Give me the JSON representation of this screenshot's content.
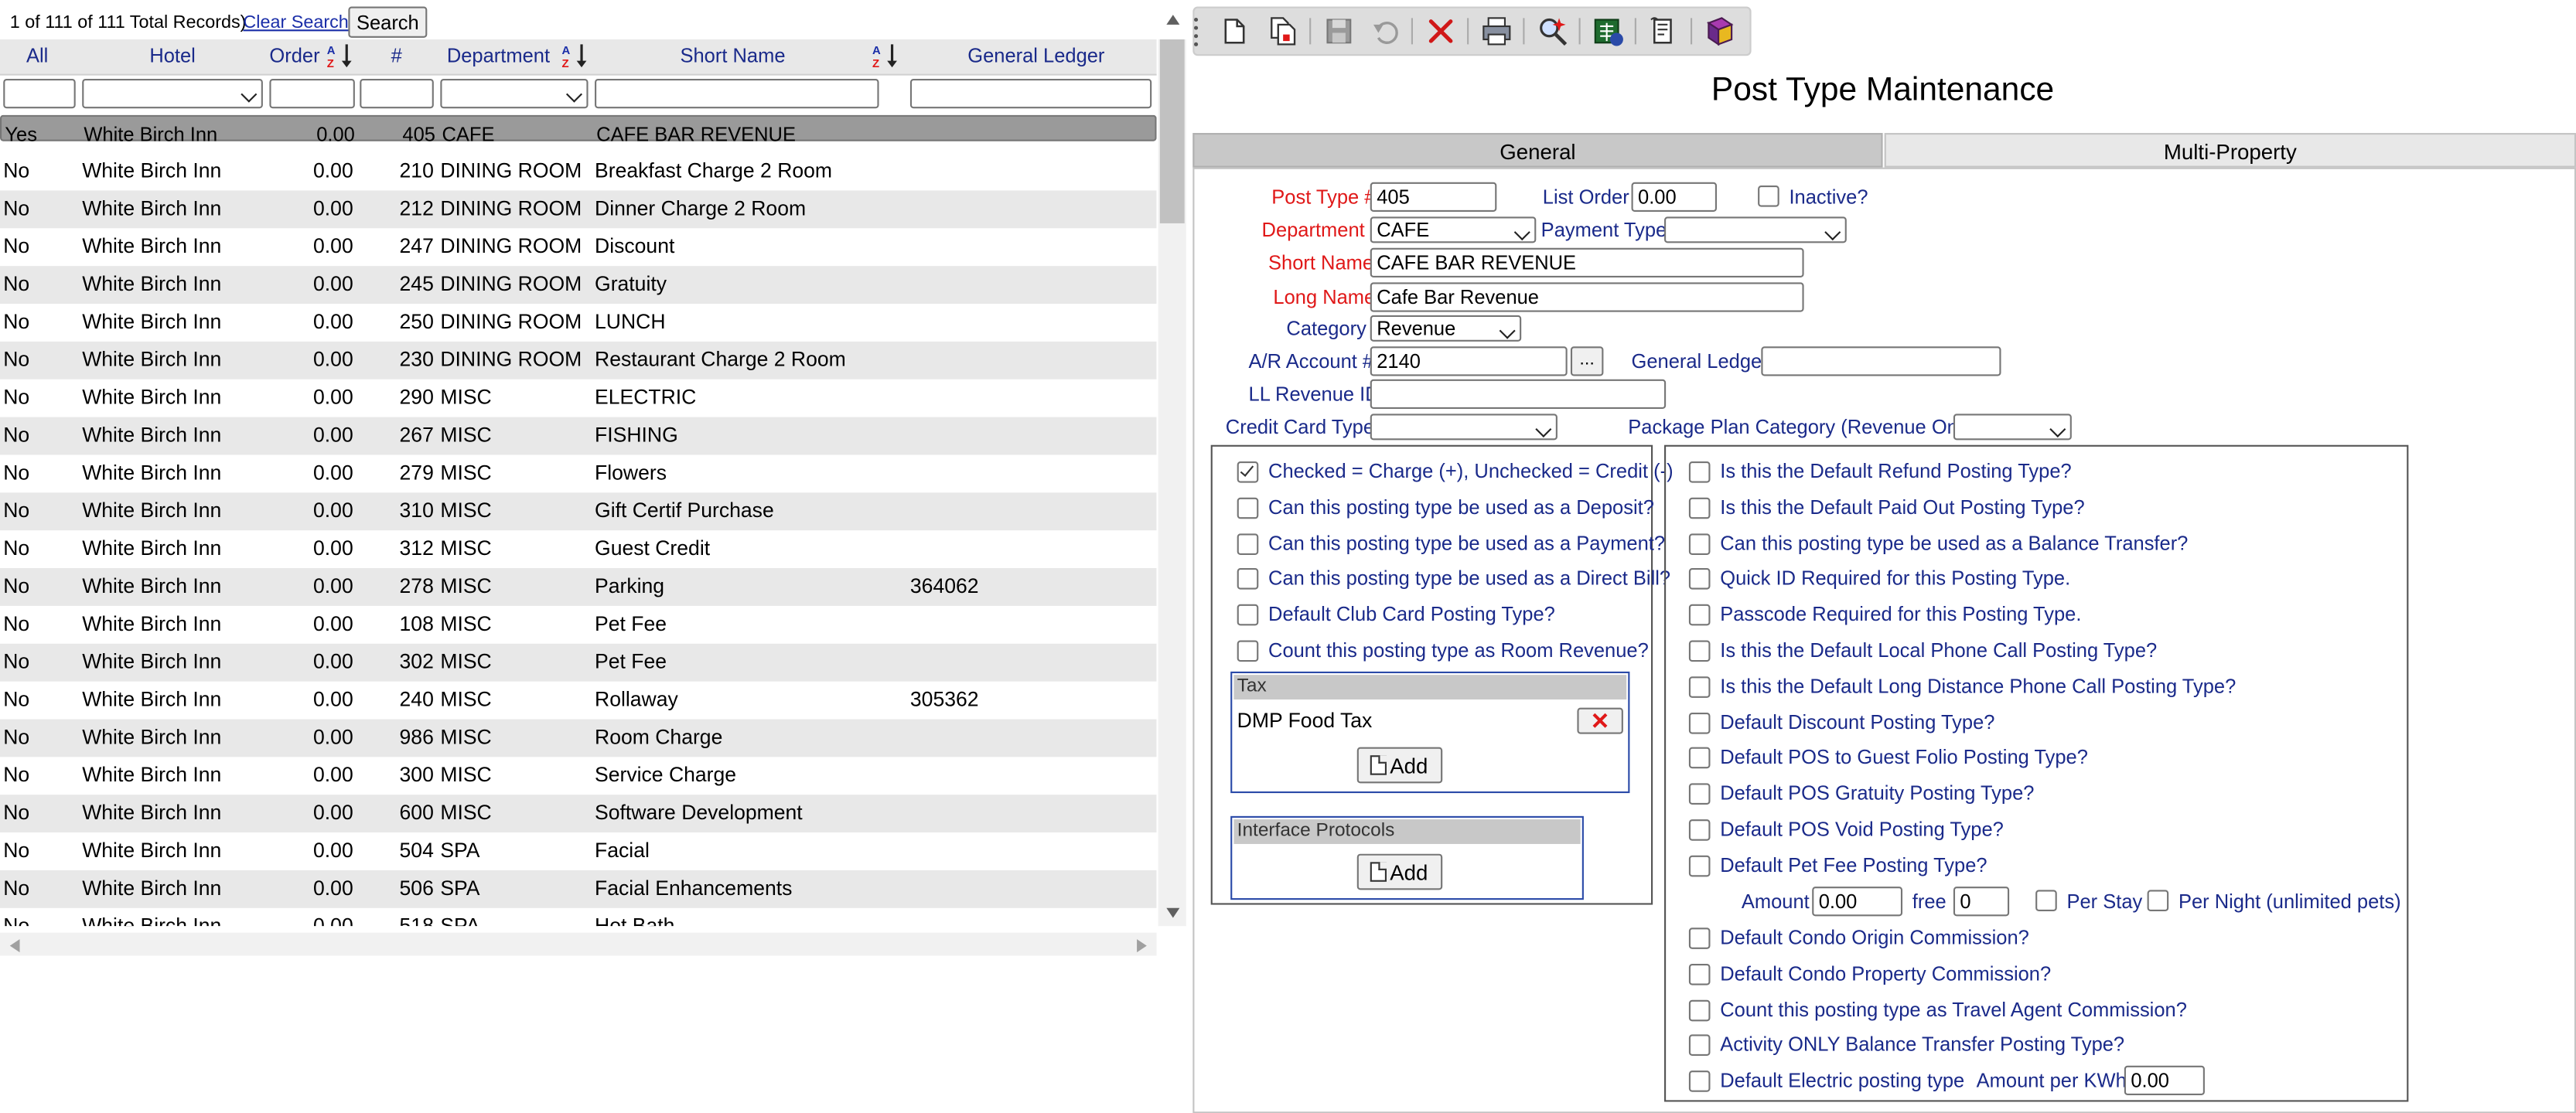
{
  "grid": {
    "record_info": "1 of 111 of 111 Total Records)",
    "clear_search": "Clear Search",
    "search_button": "Search",
    "columns": {
      "all": "All",
      "hotel": "Hotel",
      "order": "Order",
      "num": "#",
      "department": "Department",
      "short_name": "Short Name",
      "general_ledger": "General Ledger"
    },
    "rows": [
      {
        "all": "Yes",
        "hotel": "White Birch Inn",
        "order": "0.00",
        "num": "405",
        "dept": "CAFE",
        "short": "CAFE BAR REVENUE",
        "gl": ""
      },
      {
        "all": "No",
        "hotel": "White Birch Inn",
        "order": "0.00",
        "num": "210",
        "dept": "DINING ROOM",
        "short": "Breakfast Charge 2 Room",
        "gl": ""
      },
      {
        "all": "No",
        "hotel": "White Birch Inn",
        "order": "0.00",
        "num": "212",
        "dept": "DINING ROOM",
        "short": "Dinner Charge 2 Room",
        "gl": ""
      },
      {
        "all": "No",
        "hotel": "White Birch Inn",
        "order": "0.00",
        "num": "247",
        "dept": "DINING ROOM",
        "short": "Discount",
        "gl": ""
      },
      {
        "all": "No",
        "hotel": "White Birch Inn",
        "order": "0.00",
        "num": "245",
        "dept": "DINING ROOM",
        "short": "Gratuity",
        "gl": ""
      },
      {
        "all": "No",
        "hotel": "White Birch Inn",
        "order": "0.00",
        "num": "250",
        "dept": "DINING ROOM",
        "short": "LUNCH",
        "gl": ""
      },
      {
        "all": "No",
        "hotel": "White Birch Inn",
        "order": "0.00",
        "num": "230",
        "dept": "DINING ROOM",
        "short": "Restaurant Charge 2 Room",
        "gl": ""
      },
      {
        "all": "No",
        "hotel": "White Birch Inn",
        "order": "0.00",
        "num": "290",
        "dept": "MISC",
        "short": "ELECTRIC",
        "gl": ""
      },
      {
        "all": "No",
        "hotel": "White Birch Inn",
        "order": "0.00",
        "num": "267",
        "dept": "MISC",
        "short": "FISHING",
        "gl": ""
      },
      {
        "all": "No",
        "hotel": "White Birch Inn",
        "order": "0.00",
        "num": "279",
        "dept": "MISC",
        "short": "Flowers",
        "gl": ""
      },
      {
        "all": "No",
        "hotel": "White Birch Inn",
        "order": "0.00",
        "num": "310",
        "dept": "MISC",
        "short": "Gift Certif Purchase",
        "gl": ""
      },
      {
        "all": "No",
        "hotel": "White Birch Inn",
        "order": "0.00",
        "num": "312",
        "dept": "MISC",
        "short": "Guest Credit",
        "gl": ""
      },
      {
        "all": "No",
        "hotel": "White Birch Inn",
        "order": "0.00",
        "num": "278",
        "dept": "MISC",
        "short": "Parking",
        "gl": "364062"
      },
      {
        "all": "No",
        "hotel": "White Birch Inn",
        "order": "0.00",
        "num": "108",
        "dept": "MISC",
        "short": "Pet Fee",
        "gl": ""
      },
      {
        "all": "No",
        "hotel": "White Birch Inn",
        "order": "0.00",
        "num": "302",
        "dept": "MISC",
        "short": "Pet Fee",
        "gl": ""
      },
      {
        "all": "No",
        "hotel": "White Birch Inn",
        "order": "0.00",
        "num": "240",
        "dept": "MISC",
        "short": "Rollaway",
        "gl": "305362"
      },
      {
        "all": "No",
        "hotel": "White Birch Inn",
        "order": "0.00",
        "num": "986",
        "dept": "MISC",
        "short": "Room Charge",
        "gl": ""
      },
      {
        "all": "No",
        "hotel": "White Birch Inn",
        "order": "0.00",
        "num": "300",
        "dept": "MISC",
        "short": "Service Charge",
        "gl": ""
      },
      {
        "all": "No",
        "hotel": "White Birch Inn",
        "order": "0.00",
        "num": "600",
        "dept": "MISC",
        "short": "Software Development",
        "gl": ""
      },
      {
        "all": "No",
        "hotel": "White Birch Inn",
        "order": "0.00",
        "num": "504",
        "dept": "SPA",
        "short": "Facial",
        "gl": ""
      },
      {
        "all": "No",
        "hotel": "White Birch Inn",
        "order": "0.00",
        "num": "506",
        "dept": "SPA",
        "short": "Facial Enhancements",
        "gl": ""
      },
      {
        "all": "No",
        "hotel": "White Birch Inn",
        "order": "0.00",
        "num": "518",
        "dept": "SPA",
        "short": "Hot Bath",
        "gl": ""
      }
    ]
  },
  "toolbar": {
    "icons": [
      "new-icon",
      "copy-icon",
      "save-icon",
      "undo-icon",
      "delete-icon",
      "print-icon",
      "search-icon",
      "export-icon",
      "report-icon",
      "help-book-icon"
    ]
  },
  "form": {
    "title": "Post Type Maintenance",
    "tabs": {
      "general": "General",
      "multi_property": "Multi-Property"
    },
    "post_type_label": "Post Type #",
    "post_type_value": "405",
    "list_order_label": "List Order",
    "list_order_value": "0.00",
    "inactive_label": "Inactive?",
    "department_label": "Department",
    "department_value": "CAFE",
    "payment_type_label": "Payment Type",
    "payment_type_value": "",
    "short_name_label": "Short Name",
    "short_name_value": "CAFE BAR REVENUE",
    "long_name_label": "Long Name",
    "long_name_value": "Cafe Bar Revenue",
    "category_label": "Category",
    "category_value": "Revenue",
    "ar_account_label": "A/R Account #",
    "ar_account_value": "2140",
    "ar_lookup": "...",
    "general_ledger_label": "General Ledger",
    "general_ledger_value": "",
    "ll_revenue_label": "LL Revenue ID",
    "ll_revenue_value": "",
    "credit_card_label": "Credit Card Type",
    "package_plan_label": "Package Plan Category (Revenue Only!)",
    "left_checks": [
      {
        "label": "Checked = Charge (+), Unchecked = Credit (-)",
        "checked": true
      },
      {
        "label": "Can this posting type be used as a Deposit?",
        "checked": false
      },
      {
        "label": "Can this posting type be used as a Payment?",
        "checked": false
      },
      {
        "label": "Can this posting type be used as a Direct Bill?",
        "checked": false
      },
      {
        "label": "Default Club Card Posting Type?",
        "checked": false
      },
      {
        "label": "Count this posting type as Room Revenue?",
        "checked": false
      }
    ],
    "tax_header": "Tax",
    "tax_item": "DMP Food Tax",
    "tax_delete": "✕",
    "add_label": "Add",
    "interface_header": "Interface Protocols",
    "right_checks": [
      {
        "label": "Is this the Default Refund Posting Type?"
      },
      {
        "label": "Is this the Default Paid Out Posting Type?"
      },
      {
        "label": "Can this posting type be used as a Balance Transfer?"
      },
      {
        "label": "Quick ID Required for this Posting Type."
      },
      {
        "label": "Passcode Required for this Posting Type."
      },
      {
        "label": "Is this the Default Local Phone Call Posting Type?"
      },
      {
        "label": "Is this the Default Long Distance Phone Call Posting Type?"
      },
      {
        "label": "Default Discount Posting Type?"
      },
      {
        "label": "Default POS to Guest Folio Posting Type?"
      },
      {
        "label": "Default POS Gratuity Posting Type?"
      },
      {
        "label": "Default POS Void Posting Type?"
      },
      {
        "label": "Default Pet Fee Posting Type?"
      }
    ],
    "amount_label": "Amount",
    "amount_value": "0.00",
    "free_label": "free",
    "free_value": "0",
    "per_stay_label": "Per Stay",
    "per_night_label": "Per Night (unlimited pets)",
    "right_checks2": [
      {
        "label": "Default Condo Origin Commission?"
      },
      {
        "label": "Default Condo Property Commission?"
      },
      {
        "label": "Count this posting type as Travel Agent Commission?"
      },
      {
        "label": "Activity ONLY Balance Transfer Posting Type?"
      }
    ],
    "electric_label": "Default Electric posting type",
    "kwh_label": "Amount per KWh",
    "kwh_value": "0.00"
  }
}
